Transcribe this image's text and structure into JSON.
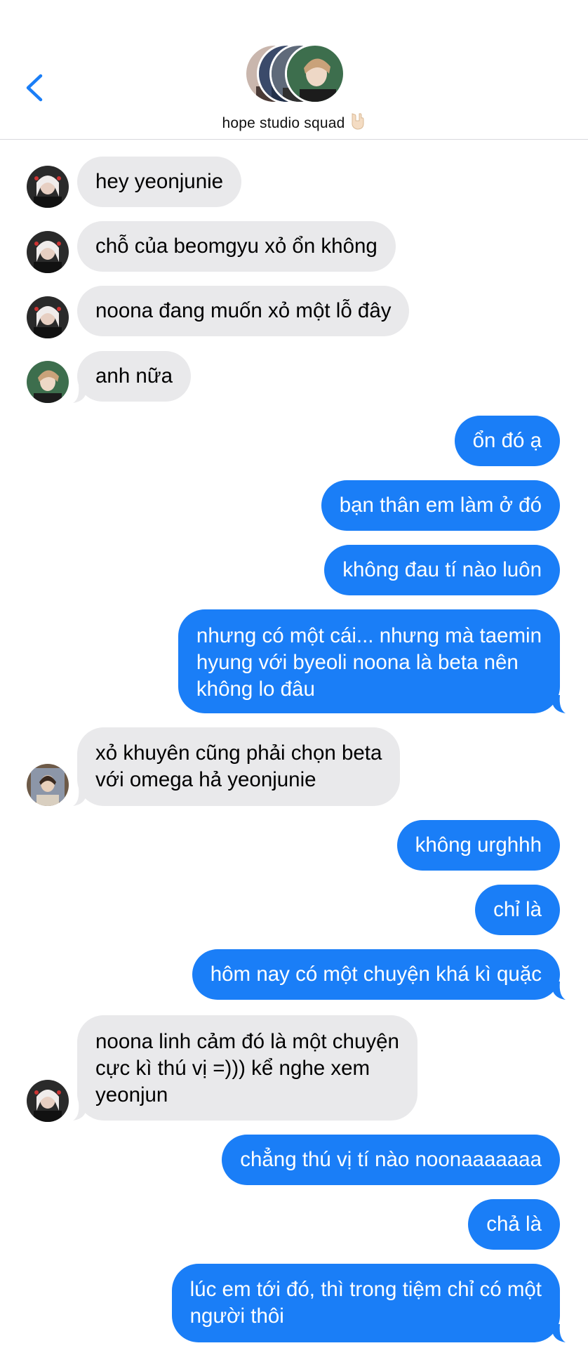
{
  "header": {
    "group_name": "hope studio squad",
    "group_emoji": "🤘🏻"
  },
  "colors": {
    "outgoing": "#1a7ef7",
    "incoming": "#e9e9eb",
    "back_icon": "#1a7ef7"
  },
  "messages": [
    {
      "dir": "in",
      "avatar": "avatar-girl",
      "lines": [
        "hey yeonjunie"
      ]
    },
    {
      "dir": "in",
      "avatar": "avatar-girl",
      "lines": [
        "chỗ của beomgyu xỏ ổn không"
      ]
    },
    {
      "dir": "in",
      "avatar": "avatar-girl",
      "lines": [
        "noona đang muốn xỏ một lỗ đây"
      ]
    },
    {
      "dir": "in",
      "avatar": "avatar-taemin",
      "lines": [
        "anh nữa"
      ]
    },
    {
      "dir": "out",
      "lines": [
        "ổn đó ạ"
      ]
    },
    {
      "dir": "out",
      "lines": [
        "bạn thân em làm ở đó"
      ]
    },
    {
      "dir": "out",
      "lines": [
        "không đau tí nào luôn"
      ]
    },
    {
      "dir": "out",
      "lines": [
        "nhưng có một cái... nhưng mà taemin",
        "hyung với byeoli noona là beta nên",
        "không lo đâu"
      ]
    },
    {
      "dir": "in",
      "avatar": "avatar-third",
      "lines": [
        "xỏ khuyên cũng phải chọn beta",
        "với omega hả yeonjunie"
      ]
    },
    {
      "dir": "out",
      "lines": [
        "không urghhh"
      ]
    },
    {
      "dir": "out",
      "lines": [
        "chỉ là"
      ]
    },
    {
      "dir": "out",
      "lines": [
        "hôm nay có một chuyện khá kì quặc"
      ]
    },
    {
      "dir": "in",
      "avatar": "avatar-girl",
      "lines": [
        "noona linh cảm đó là một chuyện",
        "cực kì thú vị =))) kể nghe xem",
        "yeonjun"
      ]
    },
    {
      "dir": "out",
      "lines": [
        "chẳng thú vị tí nào noonaaaaaaa"
      ]
    },
    {
      "dir": "out",
      "lines": [
        "chả là"
      ]
    },
    {
      "dir": "out",
      "lines": [
        "lúc em tới đó, thì trong tiệm chỉ có một",
        "người thôi"
      ]
    }
  ]
}
